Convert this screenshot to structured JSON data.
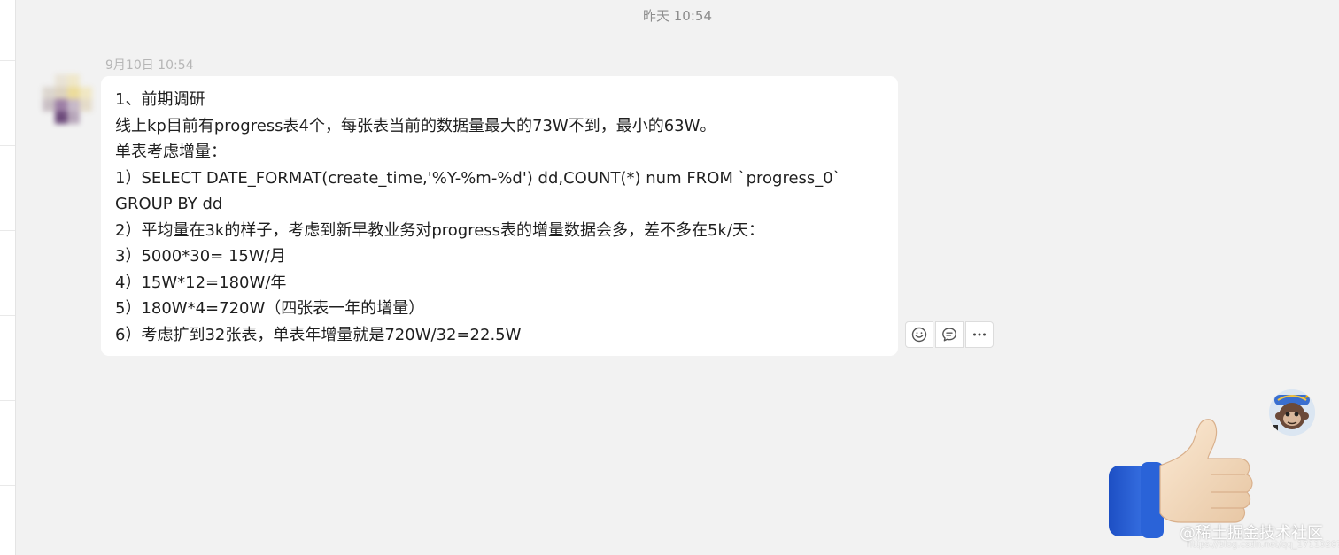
{
  "header": {
    "day_stamp": "昨天 10:54"
  },
  "message": {
    "time": "9月10日 10:54",
    "lines": [
      "1、前期调研",
      "线上kp目前有progress表4个，每张表当前的数据量最大的73W不到，最小的63W。",
      "单表考虑增量：",
      "1）SELECT DATE_FORMAT(create_time,'%Y-%m-%d') dd,COUNT(*) num FROM `progress_0`",
      "GROUP BY dd",
      "2）平均量在3k的样子，考虑到新早教业务对progress表的增量数据会多，差不多在5k/天：",
      "3）5000*30= 15W/月",
      "4）15W*12=180W/年",
      "5）180W*4=720W（四张表一年的增量）",
      "6）考虑扩到32张表，单表年增量就是720W/32=22.5W"
    ]
  },
  "actions": {
    "icons": [
      "emoji-icon",
      "comment-icon",
      "more-icon"
    ]
  },
  "sticker": {
    "icon": "thumbs-up-icon"
  },
  "watermark": {
    "text": "@稀土掘金技术社区",
    "url": "https://blog.csdn.net/qq_17110207"
  },
  "colors": {
    "background": "#f2f2f2",
    "bubble": "#ffffff",
    "text": "#1f1f1f",
    "timestamp": "#8c8c8c",
    "sleeve": "#2a63d8"
  }
}
